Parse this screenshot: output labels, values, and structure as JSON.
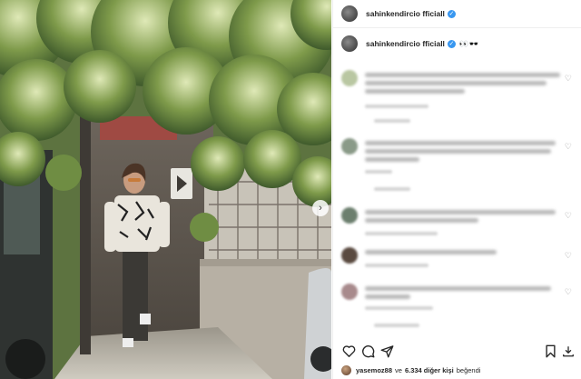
{
  "post": {
    "username": "sahinkendircio fficiall",
    "caption_user": "sahinkendircio fficiall",
    "caption_emoji": "👀🕶️",
    "liked_by_user": "yasemoz88",
    "likes_middle": "ve",
    "likes_count": "6.334 diğer kişi",
    "likes_suffix": "beğendi"
  },
  "icons": {
    "verified": "verified-badge-icon",
    "more": "more-options-icon",
    "heart": "heart-icon",
    "comment": "comment-icon",
    "share": "share-icon",
    "bookmark": "bookmark-icon",
    "download": "download-icon",
    "next": "chevron-right-icon"
  },
  "colors": {
    "verified_blue": "#3897f0",
    "text_primary": "#262626",
    "text_secondary": "#8e8e8e",
    "divider": "#efefef"
  }
}
